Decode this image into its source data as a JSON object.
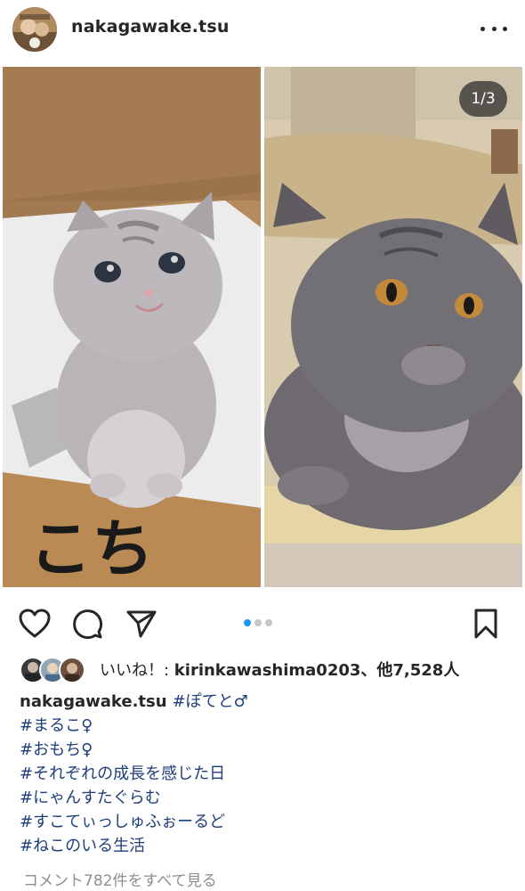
{
  "post": {
    "username": "nakagawake.tsu",
    "page_counter": "1/3",
    "carousel": {
      "total": 3,
      "active_index": 0
    },
    "likes": {
      "prefix": "いいね！: ",
      "liker": "kirinkawashima0203",
      "suffix": "、他7,528人"
    },
    "caption": {
      "username": "nakagawake.tsu",
      "first_hashtag": "#ぽてと♂",
      "hashtags": [
        "#まるこ♀",
        "#おもち♀",
        "#それぞれの成長を感じた日",
        "#にゃんすたぐらむ",
        "#すこてぃっしゅふぉーるど",
        "#ねこのいる生活"
      ]
    },
    "view_comments": "コメント782件をすべて見る",
    "box_text": "こち"
  },
  "icons": {
    "more": "more-options-icon",
    "like": "heart-icon",
    "comment": "comment-bubble-icon",
    "share": "paper-plane-icon",
    "save": "bookmark-icon"
  },
  "colors": {
    "hashtag": "#1f3f7a",
    "active_dot": "#1c96f0",
    "inactive_dot": "#c7c7c7",
    "muted_text": "#8e8e8e"
  }
}
